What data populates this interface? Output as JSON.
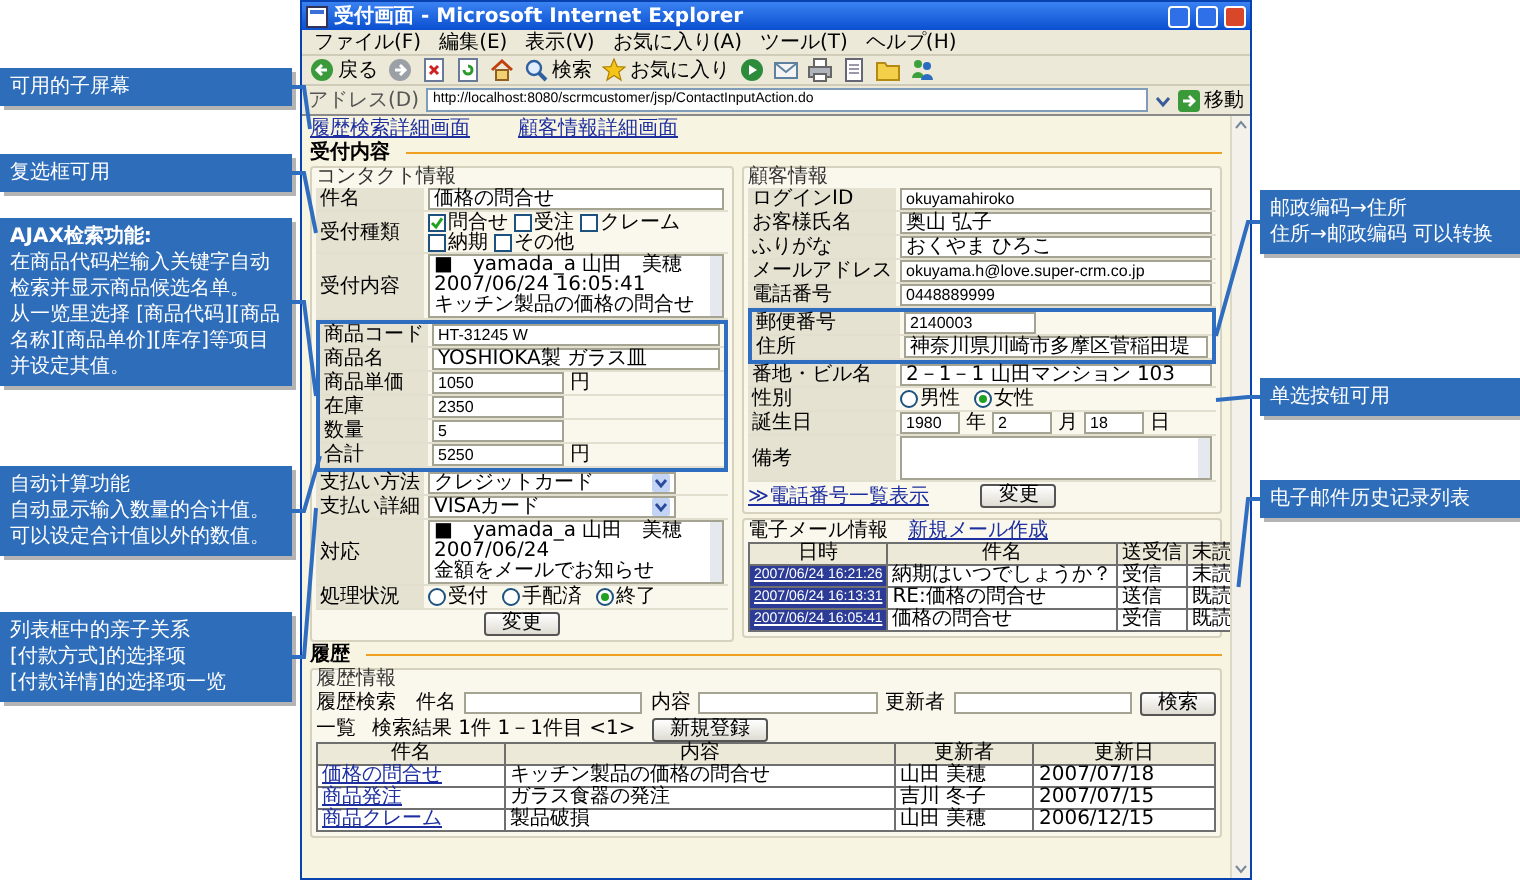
{
  "callouts_left": [
    {
      "lines": [
        "可用的子屏幕"
      ]
    },
    {
      "lines": [
        "复选框可用"
      ]
    },
    {
      "lines": [
        "**AJAX检索功能:**",
        "在商品代码栏输入关键字自动检索并显示商品候选名单。",
        "从一览里选择 [商品代码][商品名称][商品单价][库存]等项目并设定其值。"
      ]
    },
    {
      "lines": [
        "自动计算功能",
        "自动显示输入数量的合计值。",
        "可以设定合计值以外的数值。"
      ]
    },
    {
      "lines": [
        "列表框中的亲子关系",
        "[付款方式]的选择项",
        "[付款详情]的选择项一览"
      ]
    }
  ],
  "callouts_right": [
    {
      "lines": [
        "邮政编码→住所",
        "住所→邮政编码 可以转换"
      ]
    },
    {
      "lines": [
        "单选按钮可用"
      ]
    },
    {
      "lines": [
        "电子邮件历史记录列表"
      ]
    }
  ],
  "browser": {
    "title": "受付画面 - Microsoft Internet Explorer",
    "menu": [
      "ファイル(F)",
      "編集(E)",
      "表示(V)",
      "お気に入り(A)",
      "ツール(T)",
      "ヘルプ(H)"
    ],
    "toolbar": [
      {
        "kind": "back",
        "label": "戻る"
      },
      {
        "kind": "forward"
      },
      {
        "kind": "stop"
      },
      {
        "kind": "refresh"
      },
      {
        "kind": "home"
      },
      {
        "kind": "search",
        "label": "検索"
      },
      {
        "kind": "favorites",
        "label": "お気に入り"
      },
      {
        "kind": "media"
      },
      {
        "kind": "mail"
      },
      {
        "kind": "print"
      },
      {
        "kind": "edit"
      },
      {
        "kind": "folder"
      },
      {
        "kind": "messenger"
      }
    ],
    "address_label": "アドレス(D)",
    "url": "http://localhost:8080/scrmcustomer/jsp/ContactInputAction.do",
    "go": "移動"
  },
  "page": {
    "links": [
      "履歴検索詳細画面",
      "顧客情報詳細画面"
    ],
    "section": "受付内容",
    "contact": {
      "title": "コンタクト情報",
      "button": "変更",
      "rows": [
        {
          "kind": "text",
          "label": "件名",
          "value": "価格の問合せ",
          "highlighted": false
        },
        {
          "kind": "checks",
          "label": "受付種類",
          "highlighted": false,
          "options": [
            {
              "label": "問合せ",
              "checked": true
            },
            {
              "label": "受注",
              "checked": false
            },
            {
              "label": "クレーム",
              "checked": false
            },
            {
              "label": "納期",
              "checked": false
            },
            {
              "label": "その他",
              "checked": false
            }
          ]
        },
        {
          "kind": "textarea",
          "label": "受付内容",
          "highlighted": false,
          "lines": [
            "■　yamada_a 山田　美穂",
            "2007/06/24 16:05:41",
            "キッチン製品の価格の問合せ"
          ]
        },
        {
          "kind": "text",
          "label": "商品コード",
          "value": "HT-31245 W",
          "highlighted": true
        },
        {
          "kind": "text",
          "label": "商品名",
          "value": "YOSHIOKA製 ガラス皿",
          "highlighted": true
        },
        {
          "kind": "unit",
          "label": "商品単価",
          "value": "1050",
          "unit": "円",
          "highlighted": true
        },
        {
          "kind": "short",
          "label": "在庫",
          "value": "2350",
          "highlighted": true
        },
        {
          "kind": "short",
          "label": "数量",
          "value": "5",
          "highlighted": true
        },
        {
          "kind": "unit",
          "label": "合計",
          "value": "5250",
          "unit": "円",
          "highlighted": true
        },
        {
          "kind": "select",
          "label": "支払い方法",
          "value": "クレジットカード",
          "highlighted": false
        },
        {
          "kind": "select",
          "label": "支払い詳細",
          "value": "VISAカード",
          "highlighted": false
        },
        {
          "kind": "textarea",
          "label": "対応",
          "highlighted": false,
          "lines": [
            "■　yamada_a 山田　美穂",
            "2007/06/24",
            "金額をメールでお知らせ"
          ]
        },
        {
          "kind": "radios",
          "label": "処理状況",
          "highlighted": false,
          "options": [
            {
              "label": "受付",
              "selected": false
            },
            {
              "label": "手配済",
              "selected": false
            },
            {
              "label": "終了",
              "selected": true
            }
          ]
        }
      ]
    },
    "customer": {
      "title": "顧客情報",
      "link": "≫電話番号一覧表示",
      "button": "変更",
      "rows": [
        {
          "kind": "text",
          "label": "ログインID",
          "value": "okuyamahiroko",
          "highlighted": false
        },
        {
          "kind": "text",
          "label": "お客様氏名",
          "value": "奥山 弘子",
          "highlighted": false
        },
        {
          "kind": "text",
          "label": "ふりがな",
          "value": "おくやま ひろこ",
          "highlighted": false
        },
        {
          "kind": "text",
          "label": "メールアドレス",
          "value": "okuyama.h@love.super-crm.co.jp",
          "highlighted": false
        },
        {
          "kind": "text",
          "label": "電話番号",
          "value": "0448889999",
          "highlighted": false
        },
        {
          "kind": "short",
          "label": "郵便番号",
          "value": "2140003",
          "highlighted": true
        },
        {
          "kind": "text",
          "label": "住所",
          "value": "神奈川県川崎市多摩区菅稲田堤",
          "highlighted": true
        },
        {
          "kind": "text",
          "label": "番地・ビル名",
          "value": "2－1－1 山田マンション 103",
          "highlighted": false
        },
        {
          "kind": "radios",
          "label": "性別",
          "highlighted": false,
          "options": [
            {
              "label": "男性",
              "selected": false
            },
            {
              "label": "女性",
              "selected": true
            }
          ]
        },
        {
          "kind": "date",
          "label": "誕生日",
          "highlighted": false,
          "parts": [
            {
              "value": "1980",
              "unit": "年"
            },
            {
              "value": "2",
              "unit": "月"
            },
            {
              "value": "18",
              "unit": "日"
            }
          ]
        },
        {
          "kind": "textarea",
          "label": "備考",
          "highlighted": false
        }
      ]
    },
    "mail": {
      "title": "電子メール情報",
      "link": "新規メール作成",
      "columns": [
        "日時",
        "件名",
        "送受信",
        "未読"
      ],
      "rows": [
        [
          "2007/06/24 16:21:26",
          "納期はいつでしょうか？",
          "受信",
          "未読"
        ],
        [
          "2007/06/24 16:13:31",
          "RE:価格の問合せ",
          "送信",
          "既読"
        ],
        [
          "2007/06/24 16:05:41",
          "価格の問合せ",
          "受信",
          "既読"
        ]
      ]
    },
    "history": {
      "title": "履歴",
      "group": "履歴情報",
      "search_title": "履歴検索",
      "fields": [
        "件名",
        "内容",
        "更新者"
      ],
      "button": "検索",
      "list_title": "一覧",
      "result": "検索結果 1件 1－1件目 <1>",
      "new_button": "新規登録",
      "columns": [
        "件名",
        "内容",
        "更新者",
        "更新日"
      ],
      "rows": [
        [
          "価格の問合せ",
          "キッチン製品の価格の問合せ",
          "山田 美穂",
          "2007/07/18"
        ],
        [
          "商品発注",
          "ガラス食器の発注",
          "吉川 冬子",
          "2007/07/15"
        ],
        [
          "商品クレーム",
          "製品破損",
          "山田 美穂",
          "2006/12/15"
        ]
      ]
    }
  }
}
